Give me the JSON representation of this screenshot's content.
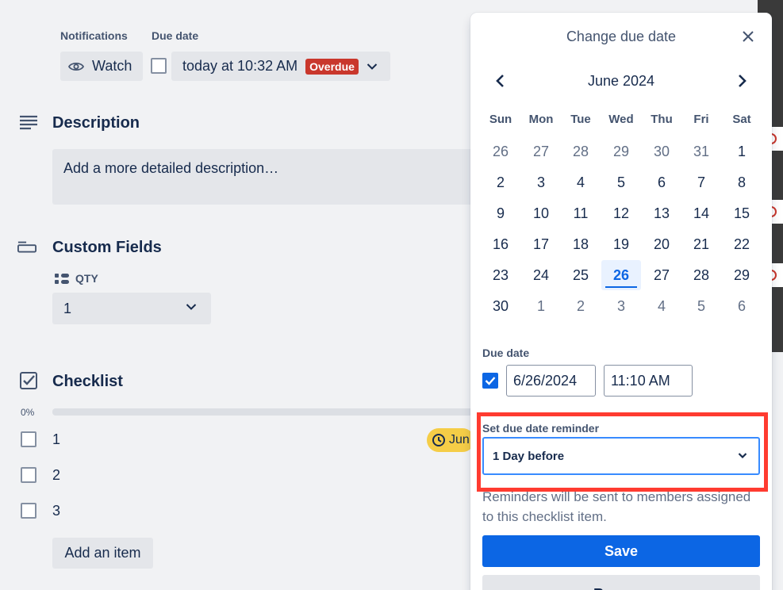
{
  "card": {
    "notifications_label": "Notifications",
    "due_date_label": "Due date",
    "watch_label": "Watch",
    "due_value": "today at 10:32 AM",
    "overdue_badge": "Overdue",
    "description_title": "Description",
    "description_placeholder": "Add a more detailed description…",
    "custom_fields_title": "Custom Fields",
    "qty_label": "QTY",
    "qty_value": "1",
    "checklist_title": "Checklist",
    "progress_label": "0%",
    "progress_value": 0,
    "items": [
      {
        "label": "1"
      },
      {
        "label": "2"
      },
      {
        "label": "3"
      }
    ],
    "item_date_chip": "Jun",
    "add_item_label": "Add an item"
  },
  "popover": {
    "title": "Change due date",
    "month": "June 2024",
    "weekdays": [
      "Sun",
      "Mon",
      "Tue",
      "Wed",
      "Thu",
      "Fri",
      "Sat"
    ],
    "weeks": [
      [
        "26",
        "27",
        "28",
        "29",
        "30",
        "31",
        "1"
      ],
      [
        "2",
        "3",
        "4",
        "5",
        "6",
        "7",
        "8"
      ],
      [
        "9",
        "10",
        "11",
        "12",
        "13",
        "14",
        "15"
      ],
      [
        "16",
        "17",
        "18",
        "19",
        "20",
        "21",
        "22"
      ],
      [
        "23",
        "24",
        "25",
        "26",
        "27",
        "28",
        "29"
      ],
      [
        "30",
        "1",
        "2",
        "3",
        "4",
        "5",
        "6"
      ]
    ],
    "selected_day": "26",
    "due_date_label": "Due date",
    "date_value": "6/26/2024",
    "time_value": "11:10 AM",
    "reminder_label": "Set due date reminder",
    "reminder_value": "1 Day before",
    "reminder_help": "Reminders will be sent to members assigned to this checklist item.",
    "save_label": "Save",
    "remove_label": "Remove"
  },
  "colors": {
    "accent": "#0c66e4",
    "overdue": "#c9372c",
    "date_chip": "#f5cd47",
    "annotation": "#ff3b30"
  }
}
